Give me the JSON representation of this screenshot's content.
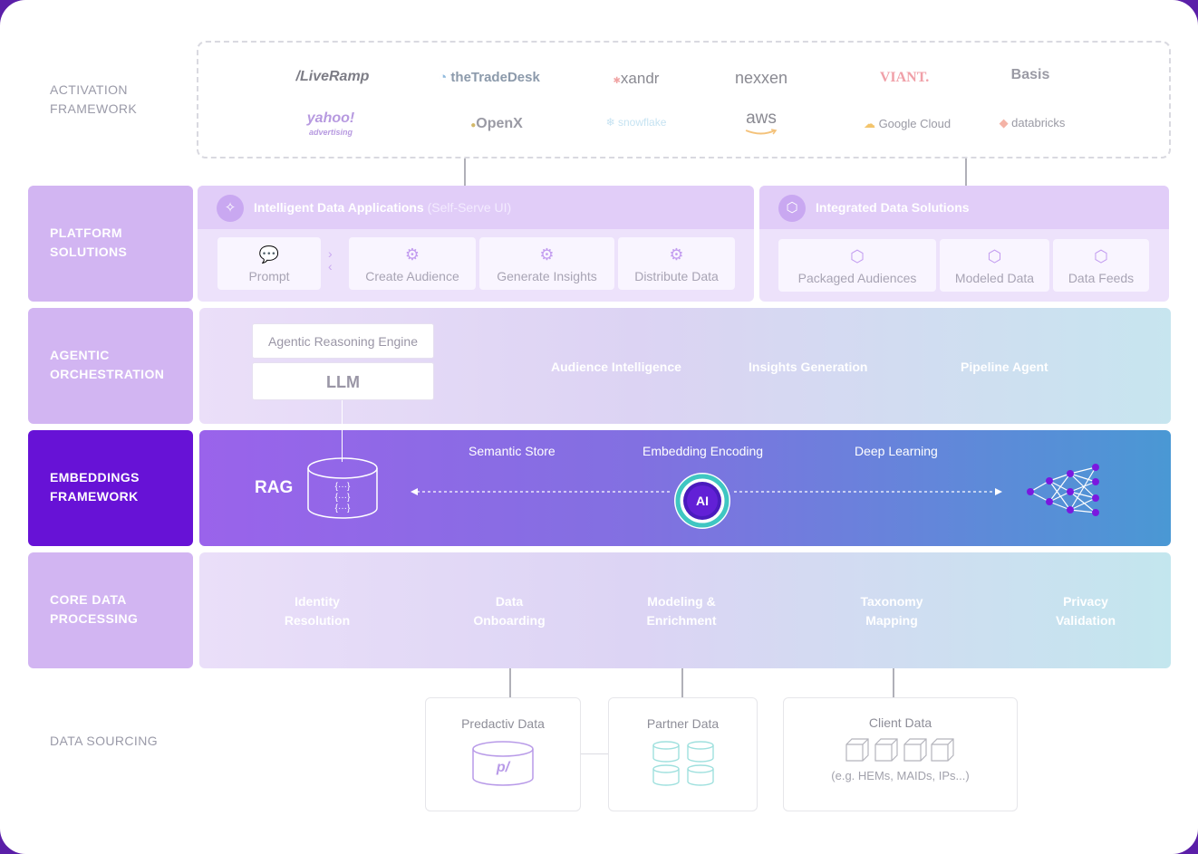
{
  "rows": {
    "activation": [
      "ACTIVATION",
      "FRAMEWORK"
    ],
    "platform": [
      "PLATFORM",
      "SOLUTIONS"
    ],
    "agentic": [
      "AGENTIC",
      "ORCHESTRATION"
    ],
    "embeddings": [
      "EMBEDDINGS",
      "FRAMEWORK"
    ],
    "core": [
      "CORE DATA",
      "PROCESSING"
    ],
    "sourcing": [
      "DATA SOURCING"
    ]
  },
  "partners": {
    "liveramp": "/LiveRamp",
    "tradedesk": "theTradeDesk",
    "xandr": "xandr",
    "nexxen": "nexxen",
    "viant": "VIANT.",
    "basis": "Basis",
    "yahoo": "yahoo!",
    "yahoo_sub": "advertising",
    "openx": "OpenX",
    "snowflake": "snowflake",
    "aws": "aws",
    "google": "Google Cloud",
    "databricks": "databricks"
  },
  "platform": {
    "apps_title": "Intelligent Data Applications",
    "apps_subtitle": "(Self-Serve UI)",
    "apps_cards": [
      "Prompt",
      "Create Audience",
      "Generate Insights",
      "Distribute Data"
    ],
    "solutions_title": "Integrated Data Solutions",
    "solutions_cards": [
      "Packaged Audiences",
      "Modeled Data",
      "Data Feeds"
    ]
  },
  "agentic": {
    "engine": "Agentic Reasoning Engine",
    "llm": "LLM",
    "items": [
      "Audience Intelligence",
      "Insights Generation",
      "Pipeline Agent"
    ]
  },
  "embeddings": {
    "rag": "RAG",
    "labels": [
      "Semantic Store",
      "Embedding Encoding",
      "Deep Learning"
    ],
    "ai": "AI"
  },
  "core": {
    "items": [
      [
        "Identity",
        "Resolution"
      ],
      [
        "Data",
        "Onboarding"
      ],
      [
        "Modeling &",
        "Enrichment"
      ],
      [
        "Taxonomy",
        "Mapping"
      ],
      [
        "Privacy",
        "Validation"
      ]
    ]
  },
  "sourcing": {
    "predactiv": "Predactiv Data",
    "partner": "Partner Data",
    "client": "Client Data",
    "client_note": "(e.g. HEMs, MAIDs, IPs...)"
  },
  "colors": {
    "accent": "#6712d6",
    "label_purple": "#d2b5f2",
    "embed_start": "#9a63eb",
    "embed_end": "#4a98d4"
  }
}
